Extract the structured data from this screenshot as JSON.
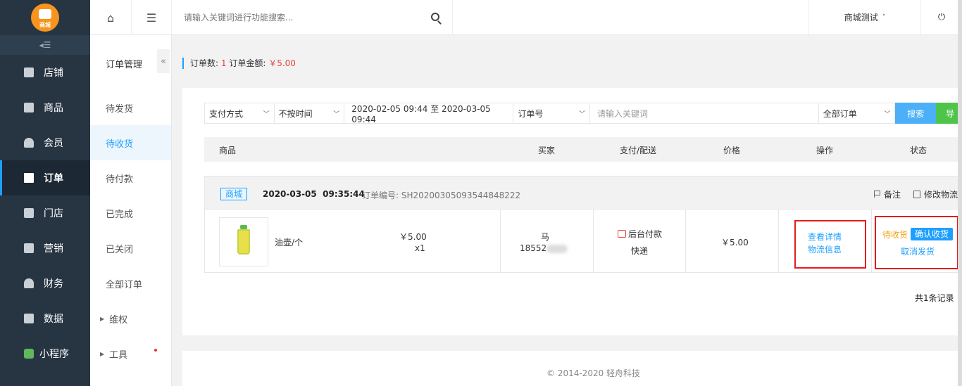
{
  "sidebar": {
    "logo_text": "商城",
    "items": [
      {
        "label": "店铺",
        "icon": "store-icon"
      },
      {
        "label": "商品",
        "icon": "goods-icon"
      },
      {
        "label": "会员",
        "icon": "member-icon"
      },
      {
        "label": "订单",
        "icon": "order-icon"
      },
      {
        "label": "门店",
        "icon": "shop-icon"
      },
      {
        "label": "营销",
        "icon": "gift-icon"
      },
      {
        "label": "财务",
        "icon": "finance-icon"
      },
      {
        "label": "数据",
        "icon": "chart-icon"
      },
      {
        "label": "小程序",
        "icon": "miniapp-icon"
      }
    ],
    "active": "订单"
  },
  "subnav": {
    "title": "订单管理",
    "items": [
      "待发货",
      "待收货",
      "待付款",
      "已完成",
      "已关闭",
      "全部订单"
    ],
    "active": "待收货",
    "groups": [
      "维权",
      "工具"
    ]
  },
  "topbar": {
    "search_placeholder": "请输入关键词进行功能搜索...",
    "shop_name": "商城测试",
    "shop_chevron": "˅"
  },
  "summary": {
    "count_label": "订单数:",
    "count": "1",
    "amount_label": "订单金额:",
    "amount": "￥5.00"
  },
  "filters": {
    "payment": "支付方式",
    "time": "不按时间",
    "date_range": "2020-02-05 09:44 至 2020-03-05 09:44",
    "field": "订单号",
    "keyword_placeholder": "请输入关键词",
    "scope": "全部订单",
    "search_label": "搜索",
    "export_label": "导"
  },
  "table_headers": [
    "商品",
    "买家",
    "支付/配送",
    "价格",
    "操作",
    "状态"
  ],
  "order": {
    "source_tag": "商城",
    "date": "2020-03-05",
    "time": "09:35:44",
    "order_no": "订单编号: SH20200305093544848222",
    "note_label": "备注",
    "modify_label": "修改物流",
    "product_name": "油壶/个",
    "unit_price": "￥5.00",
    "quantity": "x1",
    "buyer_name": "马",
    "buyer_phone": "18552",
    "payment_method": "后台付款",
    "delivery": "快递",
    "price": "￥5.00",
    "view_detail": "查看详情",
    "logistics": "物流信息",
    "status": "待收货",
    "confirm_label": "确认收货",
    "cancel_label": "取消发货"
  },
  "total_records": "共1条记录",
  "footer": "© 2014-2020 轻舟科技",
  "colors": {
    "accent": "#1e9fff",
    "sidebar": "#273543",
    "danger": "#e31b1b",
    "pending": "#f0a40c",
    "export": "#4fc44a"
  }
}
